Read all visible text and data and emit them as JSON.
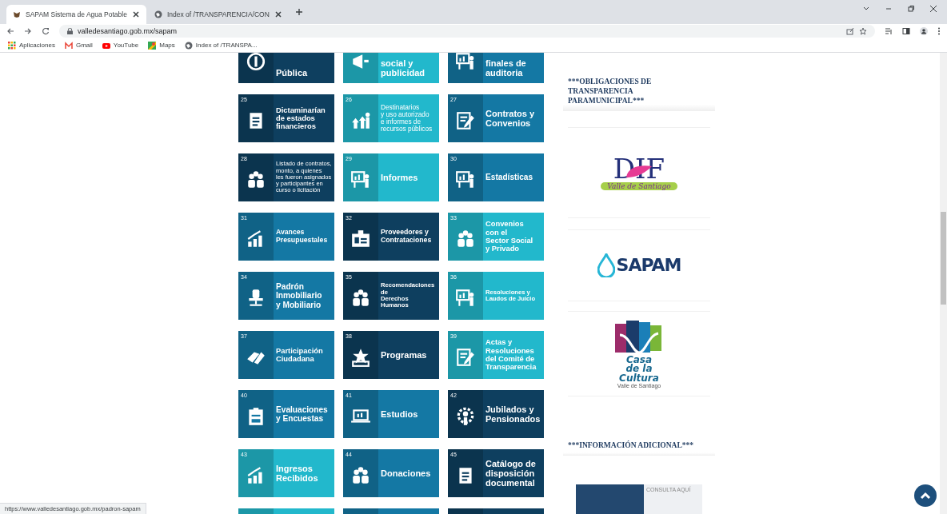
{
  "browser": {
    "tabs": [
      {
        "title": "SAPAM Sistema de Agua Potable",
        "selected": true
      },
      {
        "title": "Index of /TRANSPARENCIA/CON",
        "selected": false
      }
    ],
    "address": "valledesantiago.gob.mx/sapam",
    "bookmarks": [
      {
        "kind": "apps",
        "label": "Aplicaciones"
      },
      {
        "kind": "gmail",
        "label": "Gmail"
      },
      {
        "kind": "youtube",
        "label": "YouTube"
      },
      {
        "kind": "maps",
        "label": "Maps"
      },
      {
        "kind": "globe",
        "label": "Index of /TRANSPA..."
      }
    ]
  },
  "tiles": [
    {
      "label": "Pública",
      "color": "#0e3f5f"
    },
    {
      "label": "social y\npublicidad",
      "color": "#22b8cc"
    },
    {
      "label": "finales de\nauditoria",
      "color": "#1478a4"
    },
    {
      "number": "25",
      "label": "Dictaminarían\nde estados\nfinancieros",
      "color": "#0e3f5f"
    },
    {
      "number": "26",
      "label": "Destinatarios\ny uso autorizado\ne informes de\nrecursos públicos",
      "color": "#22b8cc"
    },
    {
      "number": "27",
      "label": "Contratos y\nConvenios",
      "color": "#1478a4"
    },
    {
      "number": "28",
      "label": "Listado de contratos,\nmonto, a quienes\nles fueron asignados\ny participantes en\ncurso o licitación",
      "color": "#0e3f5f"
    },
    {
      "number": "29",
      "label": "Informes",
      "color": "#22b8cc"
    },
    {
      "number": "30",
      "label": "Estadísticas",
      "color": "#1478a4"
    },
    {
      "number": "31",
      "label": "Avances\nPresupuestales",
      "color": "#1478a4"
    },
    {
      "number": "32",
      "label": "Proveedores y\nContrataciones",
      "color": "#0e3f5f"
    },
    {
      "number": "33",
      "label": "Convenios\ncon el\nSector Social\ny Privado",
      "color": "#22b8cc"
    },
    {
      "number": "34",
      "label": "Padrón\nInmobiliario\ny Mobiliario",
      "color": "#1478a4"
    },
    {
      "number": "35",
      "label": "Recomendaciones\nde\nDerechos Humanos",
      "color": "#0e3f5f"
    },
    {
      "number": "36",
      "label": "Resoluciones y\nLaudos de Juicio",
      "color": "#22b8cc"
    },
    {
      "number": "37",
      "label": "Participación\nCiudadana",
      "color": "#1478a4"
    },
    {
      "number": "38",
      "label": "Programas",
      "color": "#0e3f5f"
    },
    {
      "number": "39",
      "label": "Actas y\nResoluciones\ndel Comité de\nTransparencia",
      "color": "#22b8cc"
    },
    {
      "number": "40",
      "label": "Evaluaciones\ny Encuestas",
      "color": "#1478a4"
    },
    {
      "number": "41",
      "label": "Estudios",
      "color": "#1478a4"
    },
    {
      "number": "42",
      "label": "Jubilados y\nPensionados",
      "color": "#0e3f5f"
    },
    {
      "number": "43",
      "label": "Ingresos\nRecibidos",
      "color": "#22b8cc"
    },
    {
      "number": "44",
      "label": "Donaciones",
      "color": "#1478a4"
    },
    {
      "number": "45",
      "label": "Catálogo de\ndisposición\ndocumental",
      "color": "#0e3f5f"
    },
    {
      "color": "#22b8cc"
    },
    {
      "color": "#1478a4"
    },
    {
      "color": "#0e3f5f"
    }
  ],
  "sidebar": {
    "heading": "***OBLIGACIONES DE TRANSPARENCIA PARAMUNICIPAL***",
    "logos": [
      {
        "kind": "dif",
        "title": "DIF",
        "subtitle": "Valle de Santiago"
      },
      {
        "kind": "sapam",
        "title": "SAPAM"
      },
      {
        "kind": "casa",
        "title": "Casa\nde la\nCultura",
        "subtitle": "Valle de Santiago"
      }
    ],
    "heading_2": "***INFORMACIÓN ADICIONAL***",
    "banner": "CONSULTA AQUÍ"
  },
  "status_url": "https://www.valledesantiago.gob.mx/padron-sapam"
}
